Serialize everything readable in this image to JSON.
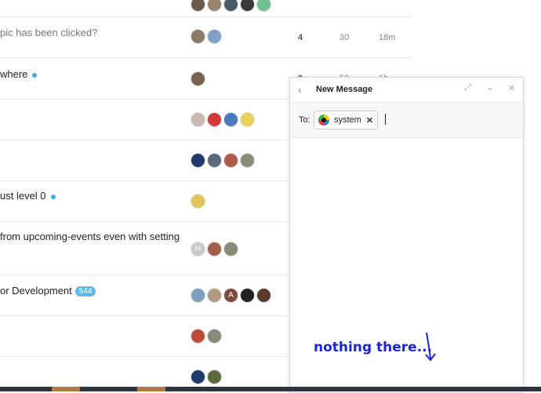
{
  "topics": [
    {
      "title": "",
      "avatars": [
        "#6b5b4c",
        "#9a8470",
        "#4a5a6a",
        "#3a3a3a",
        "#6cc18f"
      ],
      "replies": "",
      "views": "",
      "activity": ""
    },
    {
      "title": "pic has been clicked?",
      "muted": true,
      "avatars": [
        "#8a7a66",
        "#7fa0c8"
      ],
      "replies": "4",
      "views": "30",
      "activity": "18m"
    },
    {
      "title": "where",
      "dot": true,
      "avatars": [
        "#7a6050"
      ],
      "replies": "0",
      "views": "50",
      "activity": "1h"
    },
    {
      "title": "",
      "avatars": [
        "#c9b9b0",
        "#d23a3a",
        "#4a7ac0",
        "#e8d25a"
      ],
      "replies": "",
      "views": "",
      "activity": ""
    },
    {
      "title": "",
      "avatars": [
        "#1e3a6b",
        "#5a6a7a",
        "#b05a4a",
        "#8a8a7a"
      ],
      "replies": "",
      "views": "",
      "activity": ""
    },
    {
      "title": "ust level 0",
      "dot": true,
      "avatars": [
        "#e2c55a"
      ],
      "replies": "",
      "views": "",
      "activity": ""
    },
    {
      "title": " from upcoming-events even with setting",
      "avatars_letter": "H",
      "avatars": [
        "#c9c9c9",
        "#a0604a",
        "#8a8a7a"
      ],
      "replies": "",
      "views": "",
      "activity": ""
    },
    {
      "title": "or Development",
      "badge": "544",
      "avatars": [
        "#7aa0c0",
        "#b09a80",
        "#7a4a3a",
        "#222222",
        "#5a3a2a"
      ],
      "avatar_letter_3": "A",
      "replies": "",
      "views": "",
      "activity": ""
    },
    {
      "title": "",
      "avatars": [
        "#c04a3a",
        "#8a8a7a"
      ],
      "replies": "",
      "views": "",
      "activity": ""
    },
    {
      "title": "",
      "avatars": [
        "#1e3a6b",
        "#5a6a3a"
      ],
      "replies": "",
      "views": "",
      "activity": ""
    }
  ],
  "composer": {
    "title": "New Message",
    "to_label": "To:",
    "recipient": "system",
    "remove_symbol": "✕",
    "back_symbol": "‹",
    "expand_symbol": "⤢",
    "collapse_symbol": "⌄",
    "close_symbol": "✕"
  },
  "annotation": "nothing there...",
  "colors": {
    "accent_blue": "#1a25d6",
    "badge": "#5fb7e8",
    "dot": "#3ab0f0"
  }
}
